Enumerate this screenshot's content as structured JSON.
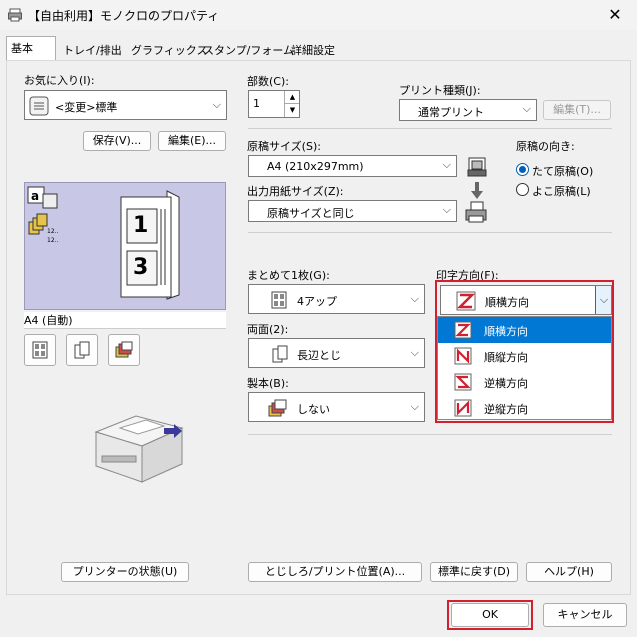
{
  "window": {
    "title": "【自由利用】モノクロのプロパティ",
    "close_glyph": "✕"
  },
  "tabs": [
    {
      "label": "基本"
    },
    {
      "label": "トレイ/排出"
    },
    {
      "label": "グラフィックス"
    },
    {
      "label": "スタンプ/フォーム"
    },
    {
      "label": "詳細設定"
    }
  ],
  "favorites": {
    "label": "お気に入り(I):",
    "value": "<変更>標準",
    "save_button": "保存(V)...",
    "edit_button": "編集(E)..."
  },
  "preview": {
    "page_numbers": [
      "1",
      "3"
    ],
    "paper_label": "A4 (自動)"
  },
  "copies": {
    "label": "部数(C):",
    "value": "1"
  },
  "print_type": {
    "label": "プリント種類(J):",
    "value": "通常プリント",
    "edit_button": "編集(T)..."
  },
  "original_size": {
    "label": "原稿サイズ(S):",
    "value": "A4 (210x297mm)"
  },
  "output_size": {
    "label": "出力用紙サイズ(Z):",
    "value": "原稿サイズと同じ"
  },
  "orientation": {
    "label": "原稿の向き:",
    "options": [
      {
        "label": "たて原稿(O)",
        "selected": true
      },
      {
        "label": "よこ原稿(L)",
        "selected": false
      }
    ]
  },
  "nup": {
    "label": "まとめて1枚(G):",
    "value": "4アップ"
  },
  "print_direction": {
    "label": "印字方向(F):",
    "value": "順横方向",
    "options": [
      "順横方向",
      "順縦方向",
      "逆横方向",
      "逆縦方向"
    ],
    "selected_index": 0
  },
  "duplex": {
    "label": "両面(2):",
    "value": "長辺とじ"
  },
  "binding": {
    "label": "製本(B):",
    "value": "しない"
  },
  "bottom": {
    "printer_status": "プリンターの状態(U)",
    "binding_position": "とじしろ/プリント位置(A)...",
    "restore_defaults": "標準に戻す(D)",
    "help": "ヘルプ(H)"
  },
  "footer": {
    "ok": "OK",
    "cancel": "キャンセル"
  },
  "colors": {
    "accent": "#0078d4",
    "highlight": "#d1202f",
    "preview_bg": "#c8c8e6"
  }
}
